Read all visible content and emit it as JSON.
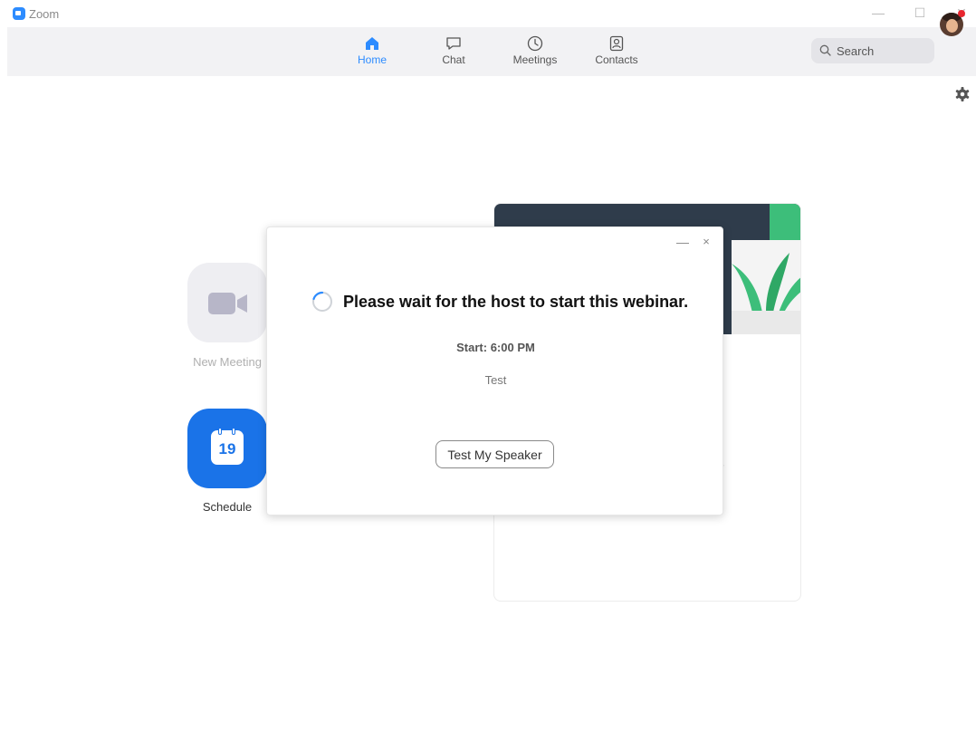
{
  "window": {
    "title": "Zoom",
    "controls": {
      "minimize": "—",
      "maximize": "☐",
      "close": "✕"
    }
  },
  "nav": {
    "tabs": [
      {
        "label": "Home",
        "icon": "home-icon",
        "active": true
      },
      {
        "label": "Chat",
        "icon": "chat-icon",
        "active": false
      },
      {
        "label": "Meetings",
        "icon": "clock-icon",
        "active": false
      },
      {
        "label": "Contacts",
        "icon": "contacts-icon",
        "active": false
      }
    ],
    "search_label": "Search"
  },
  "home": {
    "new_meeting_label": "New Meeting",
    "schedule_label": "Schedule",
    "calendar_day": "19"
  },
  "background_card": {
    "stray_char": "/"
  },
  "dialog": {
    "minimize": "—",
    "close": "×",
    "headline": "Please wait for the host to start this webinar.",
    "start_time": "Start: 6:00 PM",
    "webinar_name": "Test",
    "test_speaker_button": "Test My Speaker"
  },
  "colors": {
    "accent": "#2D8CFF",
    "nav_bg": "#F2F2F4",
    "disabled_tile": "#EEEEF2",
    "notification": "#E8262E",
    "card_banner": "#2F3C4B",
    "plant_green": "#3DBE7A"
  }
}
